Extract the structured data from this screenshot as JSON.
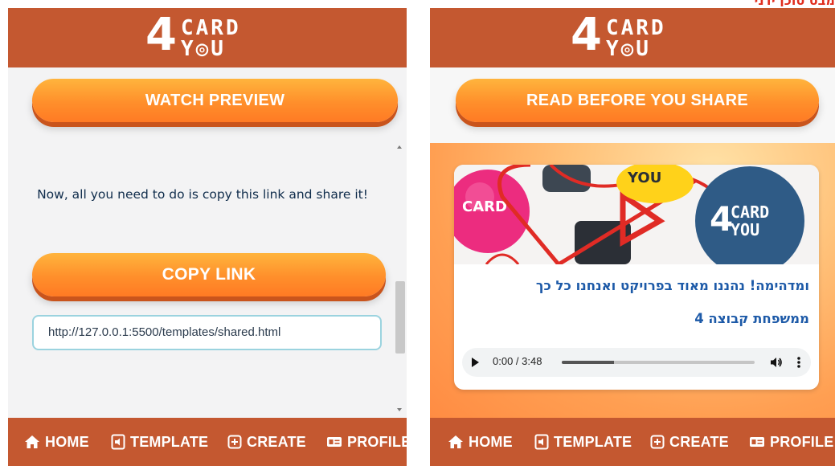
{
  "top_title": "מבט סוכן ידני",
  "left": {
    "logo": {
      "digit": "4",
      "word_top": "CARD",
      "word_bottom": "Y◎U"
    },
    "watch_preview_label": "WATCH PREVIEW",
    "info_text": "Now, all you need to do is copy this link and share it!",
    "copy_link_label": "COPY LINK",
    "link_value": "http://127.0.0.1:5500/templates/shared.html",
    "nav": [
      {
        "label": "HOME",
        "icon": "home-icon"
      },
      {
        "label": "TEMPLATE",
        "icon": "template-icon"
      },
      {
        "label": "CREATE",
        "icon": "create-icon"
      },
      {
        "label": "PROFILE",
        "icon": "profile-icon"
      }
    ]
  },
  "right": {
    "logo": {
      "digit": "4",
      "word_top": "CARD",
      "word_bottom": "Y◎U"
    },
    "read_before_label": "READ BEFORE YOU SHARE",
    "card": {
      "caption_line1": "ומדהימה! נהננו מאוד בפרויקט ואנחנו כל כך",
      "caption_line2": "ממשפחת קבוצה 4",
      "audio": {
        "time": "0:00 / 3:48",
        "progress": 0.27
      }
    },
    "nav": [
      {
        "label": "HOME",
        "icon": "home-icon"
      },
      {
        "label": "TEMPLATE",
        "icon": "template-icon"
      },
      {
        "label": "CREATE",
        "icon": "create-icon"
      },
      {
        "label": "PROFILE",
        "icon": "profile-icon"
      }
    ]
  },
  "colors": {
    "header": "#c45830",
    "button": "#ff8f2b",
    "caption": "#1d5aa8"
  }
}
